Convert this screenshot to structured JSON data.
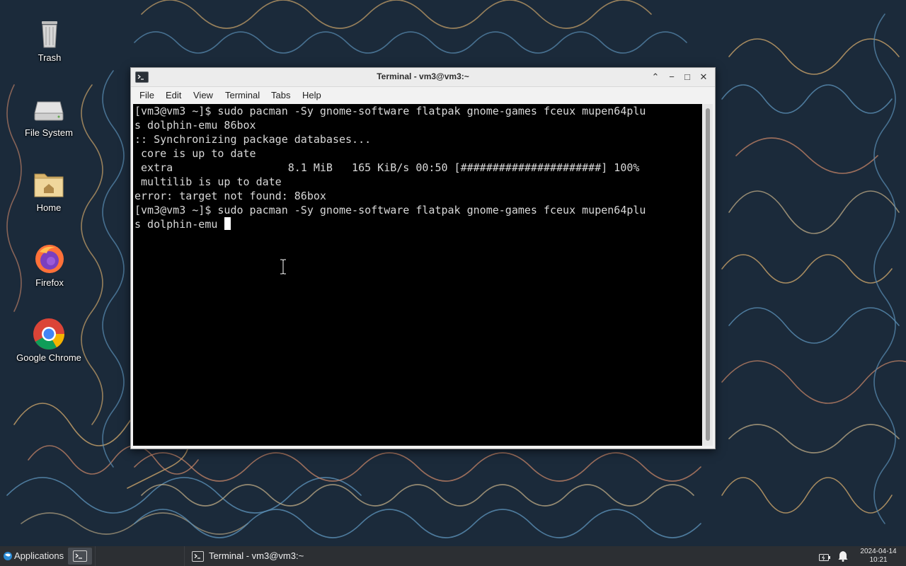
{
  "desktop": {
    "icons": [
      {
        "label": "Trash",
        "icon": "trash-icon"
      },
      {
        "label": "File System",
        "icon": "drive-icon"
      },
      {
        "label": "Home",
        "icon": "home-folder-icon"
      },
      {
        "label": "Firefox",
        "icon": "firefox-icon"
      },
      {
        "label": "Google Chrome",
        "icon": "chrome-icon"
      }
    ]
  },
  "window": {
    "title": "Terminal - vm3@vm3:~",
    "controls": {
      "minimize_up": "⌃",
      "minimize": "−",
      "maximize": "□",
      "close": "✕"
    }
  },
  "menu": {
    "file": "File",
    "edit": "Edit",
    "view": "View",
    "terminal": "Terminal",
    "tabs": "Tabs",
    "help": "Help"
  },
  "terminal": {
    "lines": [
      "[vm3@vm3 ~]$ sudo pacman -Sy gnome-software flatpak gnome-games fceux mupen64plu",
      "s dolphin-emu 86box",
      ":: Synchronizing package databases...",
      " core is up to date",
      " extra                  8.1 MiB   165 KiB/s 00:50 [######################] 100%",
      " multilib is up to date",
      "error: target not found: 86box",
      "[vm3@vm3 ~]$ sudo pacman -Sy gnome-software flatpak gnome-games fceux mupen64plu",
      "s dolphin-emu "
    ],
    "background": "#000000",
    "foreground": "#d8d8d8"
  },
  "taskbar": {
    "applications_label": "Applications",
    "task_label": "Terminal - vm3@vm3:~",
    "clock_date": "2024-04-14",
    "clock_time": "10:21"
  }
}
